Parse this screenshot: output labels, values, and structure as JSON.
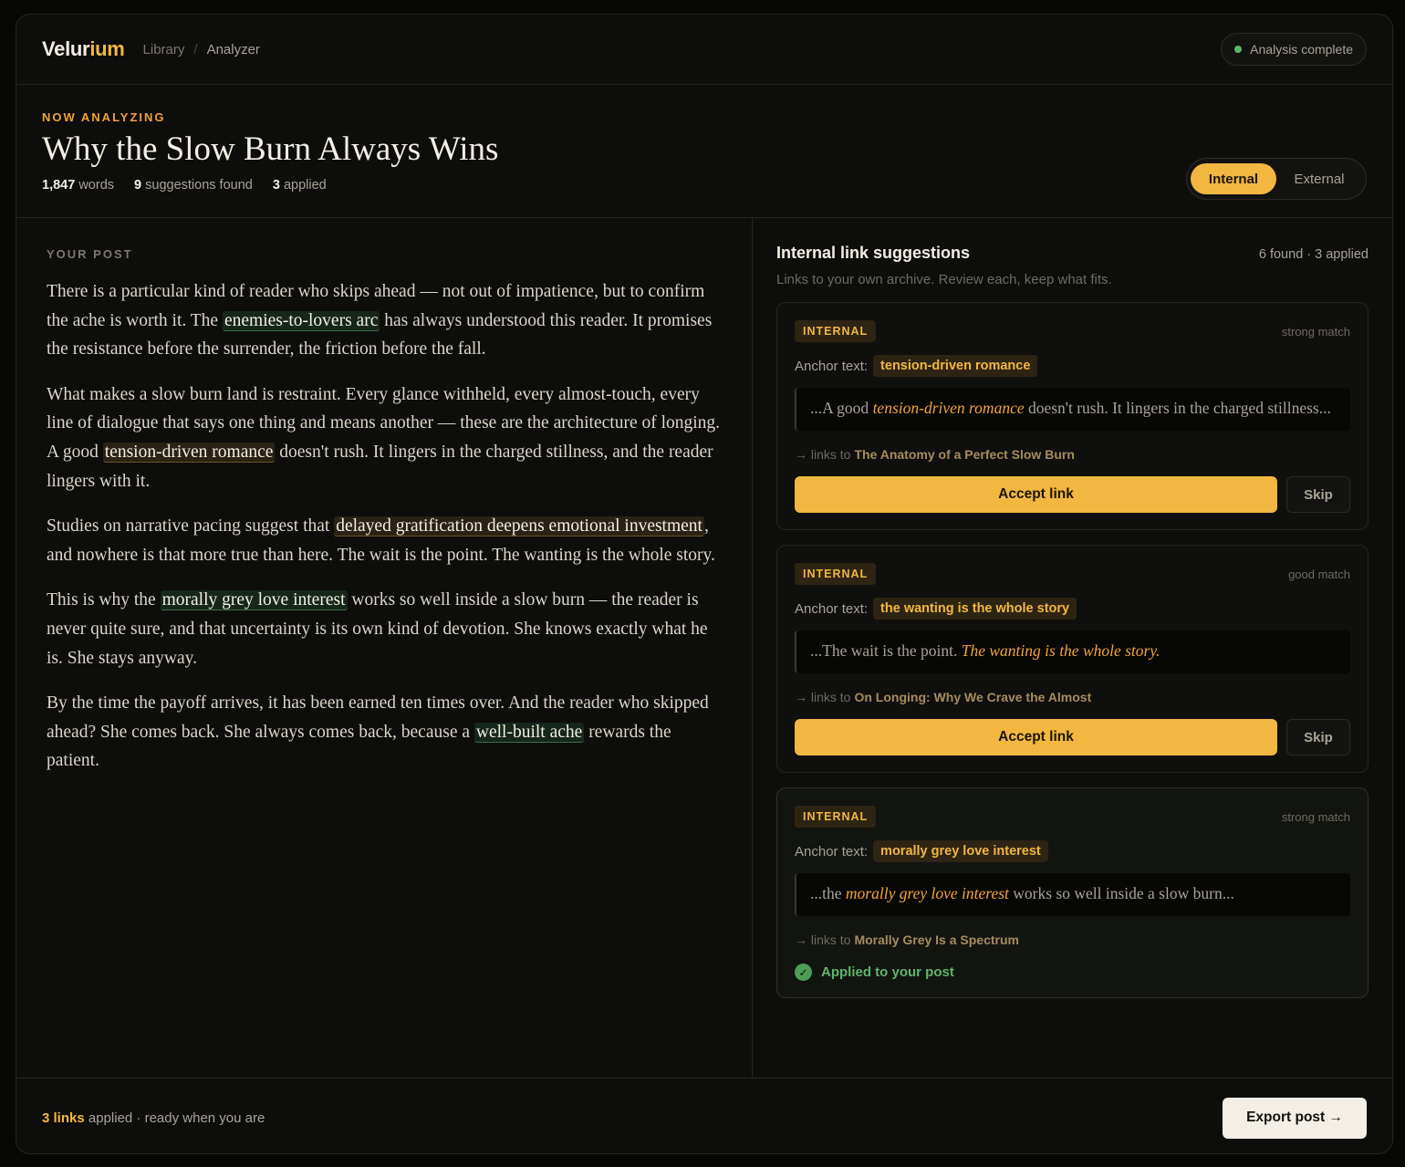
{
  "brand": {
    "name_part1": "Velur",
    "name_part2": "ium"
  },
  "breadcrumb": {
    "library": "Library",
    "separator": "/",
    "current": "Analyzer"
  },
  "status": {
    "label": "Analysis complete",
    "dot_color": "#5fb56a"
  },
  "header": {
    "eyebrow": "NOW ANALYZING",
    "title": "Why the Slow Burn Always Wins",
    "stats": {
      "words_value": "1,847",
      "words_label": "words",
      "suggestions_value": "9",
      "suggestions_label": "suggestions found",
      "applied_value": "3",
      "applied_label": "applied"
    }
  },
  "toggle": {
    "internal": "Internal",
    "external": "External",
    "active": "Internal"
  },
  "post": {
    "label": "YOUR POST",
    "p1": {
      "a": "There is a particular kind of reader who skips ahead — not out of impatience, but to confirm the ache is worth it. The ",
      "hl": "enemies-to-lovers arc",
      "b": " has always understood this reader. It promises the resistance before the surrender, the friction before the fall."
    },
    "p2": {
      "a": "What makes a slow burn land is restraint. Every glance withheld, every almost-touch, every line of dialogue that says one thing and means another — these are the architecture of longing. A good ",
      "hl": "tension-driven romance",
      "b": " doesn't rush. It lingers in the charged stillness, and the reader lingers with it."
    },
    "p3": {
      "a": "Studies on narrative pacing suggest that ",
      "hl": "delayed gratification deepens emotional investment",
      "b": ", and nowhere is that more true than here. The wait is the point. The wanting is the whole story."
    },
    "p4": {
      "a": "This is why the ",
      "hl": "morally grey love interest",
      "b": " works so well inside a slow burn — the reader is never quite sure, and that uncertainty is its own kind of devotion. She knows exactly what he is. She stays anyway."
    },
    "p5": {
      "a": "By the time the payoff arrives, it has been earned ten times over. And the reader who skipped ahead? She comes back. She always comes back, because a ",
      "hl": "well-built ache",
      "b": " rewards the patient."
    }
  },
  "panel": {
    "title": "Internal link suggestions",
    "count": "6 found · 3 applied",
    "subtitle": "Links to your own archive. Review each, keep what fits.",
    "anchor_label": "Anchor text:",
    "links_to_label": "→ links to",
    "accept_label": "Accept link",
    "skip_label": "Skip",
    "applied_label": "Applied to your post",
    "cards": [
      {
        "badge": "INTERNAL",
        "match": "strong match",
        "anchor": "tension-driven romance",
        "quote_pre": "...A good ",
        "quote_em": "tension-driven romance",
        "quote_post": " doesn't rush. It lingers in the charged stillness...",
        "target": "The Anatomy of a Perfect Slow Burn"
      },
      {
        "badge": "INTERNAL",
        "match": "good match",
        "anchor": "the wanting is the whole story",
        "quote_pre": "...The wait is the point. ",
        "quote_em": "The wanting is the whole story.",
        "quote_post": "",
        "target": "On Longing: Why We Crave the Almost"
      },
      {
        "badge": "INTERNAL",
        "match": "strong match",
        "anchor": "morally grey love interest",
        "quote_pre": "...the ",
        "quote_em": "morally grey love interest",
        "quote_post": " works so well inside a slow burn...",
        "target": "Morally Grey Is a Spectrum"
      }
    ]
  },
  "footer": {
    "links_count": "3 links",
    "status_text": " applied · ready when you are",
    "export_label": "Export post →"
  },
  "colors": {
    "accent": "#f2b740",
    "applied": "#5fb56a",
    "background": "#0d0d0c"
  }
}
